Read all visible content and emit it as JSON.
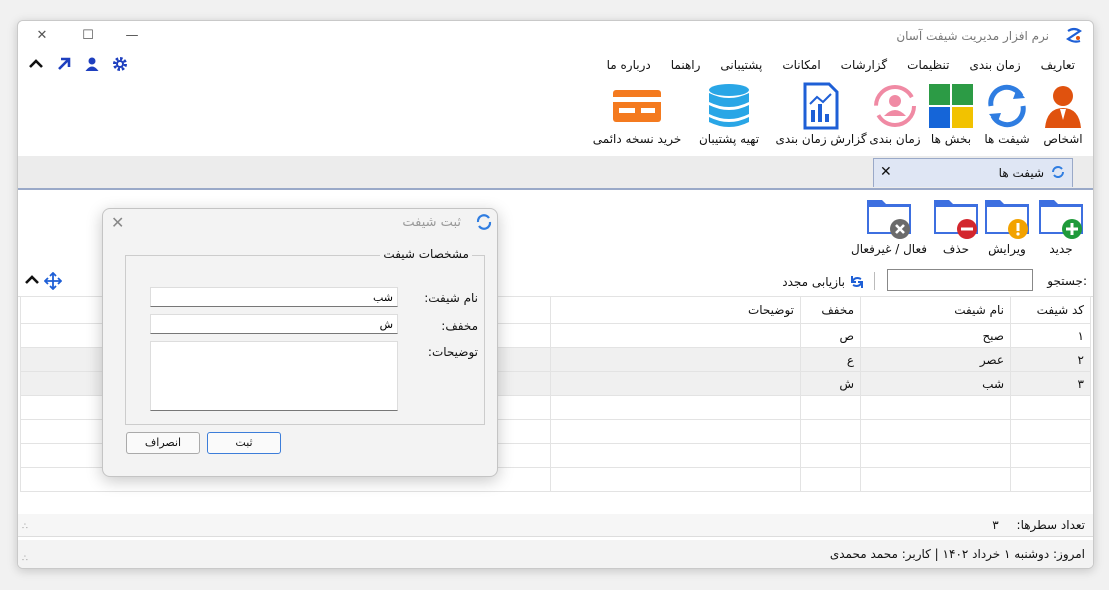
{
  "app": {
    "title": "نرم افزار مدیریت شیفت آسان"
  },
  "menu": [
    "تعاریف",
    "زمان بندی",
    "تنظیمات",
    "گزارشات",
    "امکانات",
    "پشتیبانی",
    "راهنما",
    "درباره ما"
  ],
  "ribbon": {
    "people": "اشخاص",
    "shifts": "شیفت ها",
    "sections": "بخش ها",
    "schedule": "زمان بندی",
    "schedule_report": "گزارش زمان بندی",
    "backup": "تهیه پشتیبان",
    "buy": "خرید نسخه دائمی"
  },
  "tab": {
    "label": "شیفت ها"
  },
  "toolbar": {
    "new": "جدید",
    "edit": "ویرایش",
    "delete": "حذف",
    "toggle": "فعال / غیرفعال"
  },
  "search": {
    "label": "جستجو:",
    "value": "",
    "refresh": "بازیابی مجدد"
  },
  "grid": {
    "columns": [
      "کد شیفت",
      "نام شیفت",
      "مخفف",
      "توضیحات"
    ],
    "rows": [
      [
        "۱",
        "صبح",
        "ص",
        ""
      ],
      [
        "۲",
        "عصر",
        "ع",
        ""
      ],
      [
        "۳",
        "شب",
        "ش",
        ""
      ]
    ]
  },
  "row_count": {
    "label": "تعداد سطرها:",
    "value": "۳"
  },
  "status": {
    "text": "امروز: دوشنبه ۱ خرداد ۱۴۰۲  |  کاربر: محمد محمدی"
  },
  "dialog": {
    "title": "ثبت شیفت",
    "group_title": "مشخصات شیفت",
    "name_label": "نام شیفت:",
    "name_value": "شب",
    "abbr_label": "مخفف:",
    "abbr_value": "ش",
    "desc_label": "توضیحات:",
    "desc_value": "",
    "save": "ثبت",
    "cancel": "انصراف"
  },
  "colors": {
    "accent": "#1e5fd6",
    "people": "#e0520e",
    "pink": "#f08aa4",
    "orange": "#f47a1f",
    "tab_bg": "#dfe6f4"
  }
}
